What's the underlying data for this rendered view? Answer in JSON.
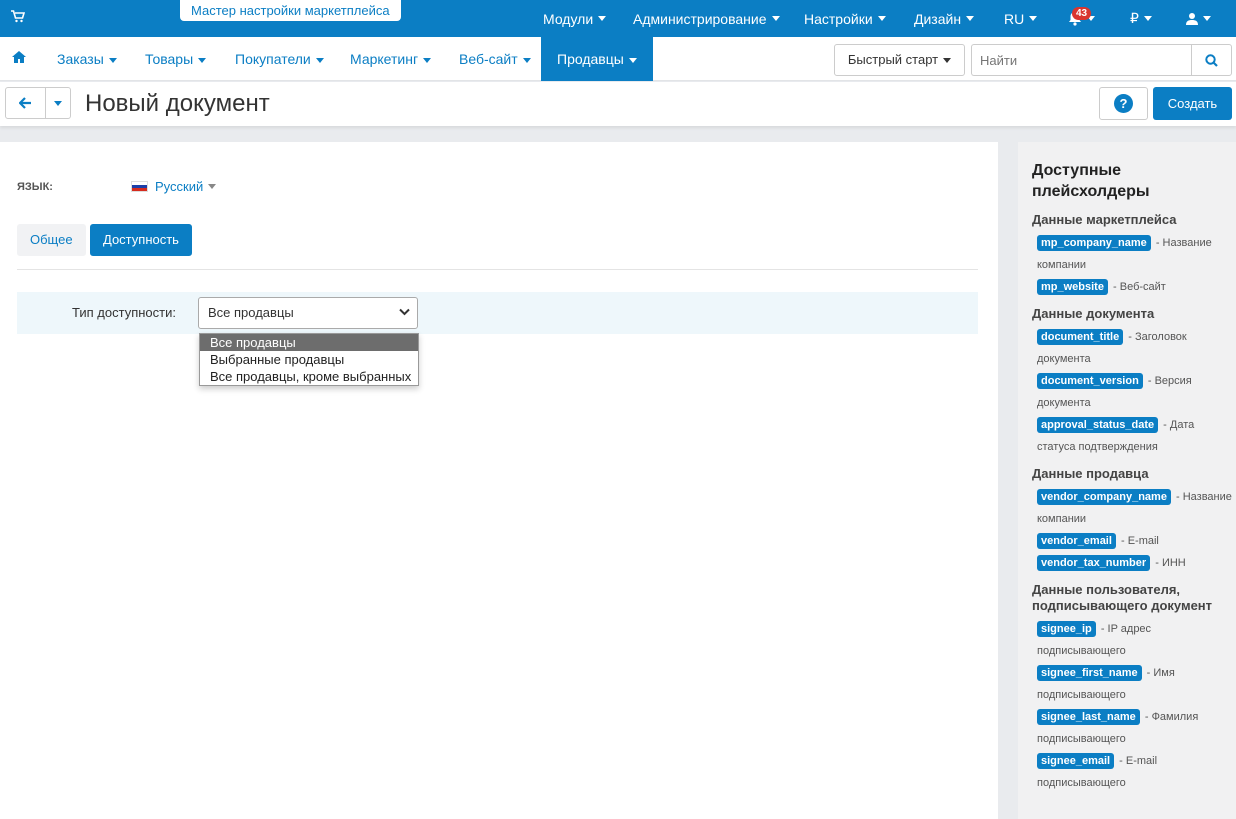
{
  "topbar": {
    "wizard_label": "Мастер настройки маркетплейса",
    "menu": [
      {
        "label": "Модули"
      },
      {
        "label": "Администрирование"
      },
      {
        "label": "Настройки"
      },
      {
        "label": "Дизайн"
      },
      {
        "label": "RU"
      }
    ],
    "notifications_count": "43",
    "currency": "₽"
  },
  "nav": {
    "items": [
      "Заказы",
      "Товары",
      "Покупатели",
      "Маркетинг",
      "Веб-сайт",
      "Продавцы"
    ],
    "active": "Продавцы",
    "quick_start": "Быстрый старт",
    "search_placeholder": "Найти"
  },
  "titlebar": {
    "title": "Новый документ",
    "create_label": "Создать"
  },
  "form": {
    "lang_label": "Язык:",
    "lang_value": "Русский",
    "tabs": [
      "Общее",
      "Доступность"
    ],
    "active_tab": "Доступность",
    "availability_label": "Тип доступности:",
    "availability_value": "Все продавцы",
    "options": [
      "Все продавцы",
      "Выбранные продавцы",
      "Все продавцы, кроме выбранных"
    ]
  },
  "sidebar": {
    "title": "Доступные плейсхолдеры",
    "groups": [
      {
        "title": "Данные маркетплейса",
        "items": [
          {
            "tag": "mp_company_name",
            "desc": "- Название компании"
          },
          {
            "tag": "mp_website",
            "desc": "- Веб-сайт"
          }
        ]
      },
      {
        "title": "Данные документа",
        "items": [
          {
            "tag": "document_title",
            "desc": "- Заголовок документа"
          },
          {
            "tag": "document_version",
            "desc": "- Версия документа"
          },
          {
            "tag": "approval_status_date",
            "desc": "- Дата статуса подтверждения"
          }
        ]
      },
      {
        "title": "Данные продавца",
        "items": [
          {
            "tag": "vendor_company_name",
            "desc": "- Название компании"
          },
          {
            "tag": "vendor_email",
            "desc": "- E-mail"
          },
          {
            "tag": "vendor_tax_number",
            "desc": "- ИНН"
          }
        ]
      },
      {
        "title": "Данные пользователя, подписывающего документ",
        "items": [
          {
            "tag": "signee_ip",
            "desc": "- IP адрес подписывающего"
          },
          {
            "tag": "signee_first_name",
            "desc": "- Имя подписывающего"
          },
          {
            "tag": "signee_last_name",
            "desc": "- Фамилия подписывающего"
          },
          {
            "tag": "signee_email",
            "desc": "- E-mail подписывающего"
          }
        ]
      }
    ]
  },
  "colors": {
    "primary": "#0b7ec4",
    "badge": "#d9352f",
    "selected_option": "#6d6d6d"
  }
}
